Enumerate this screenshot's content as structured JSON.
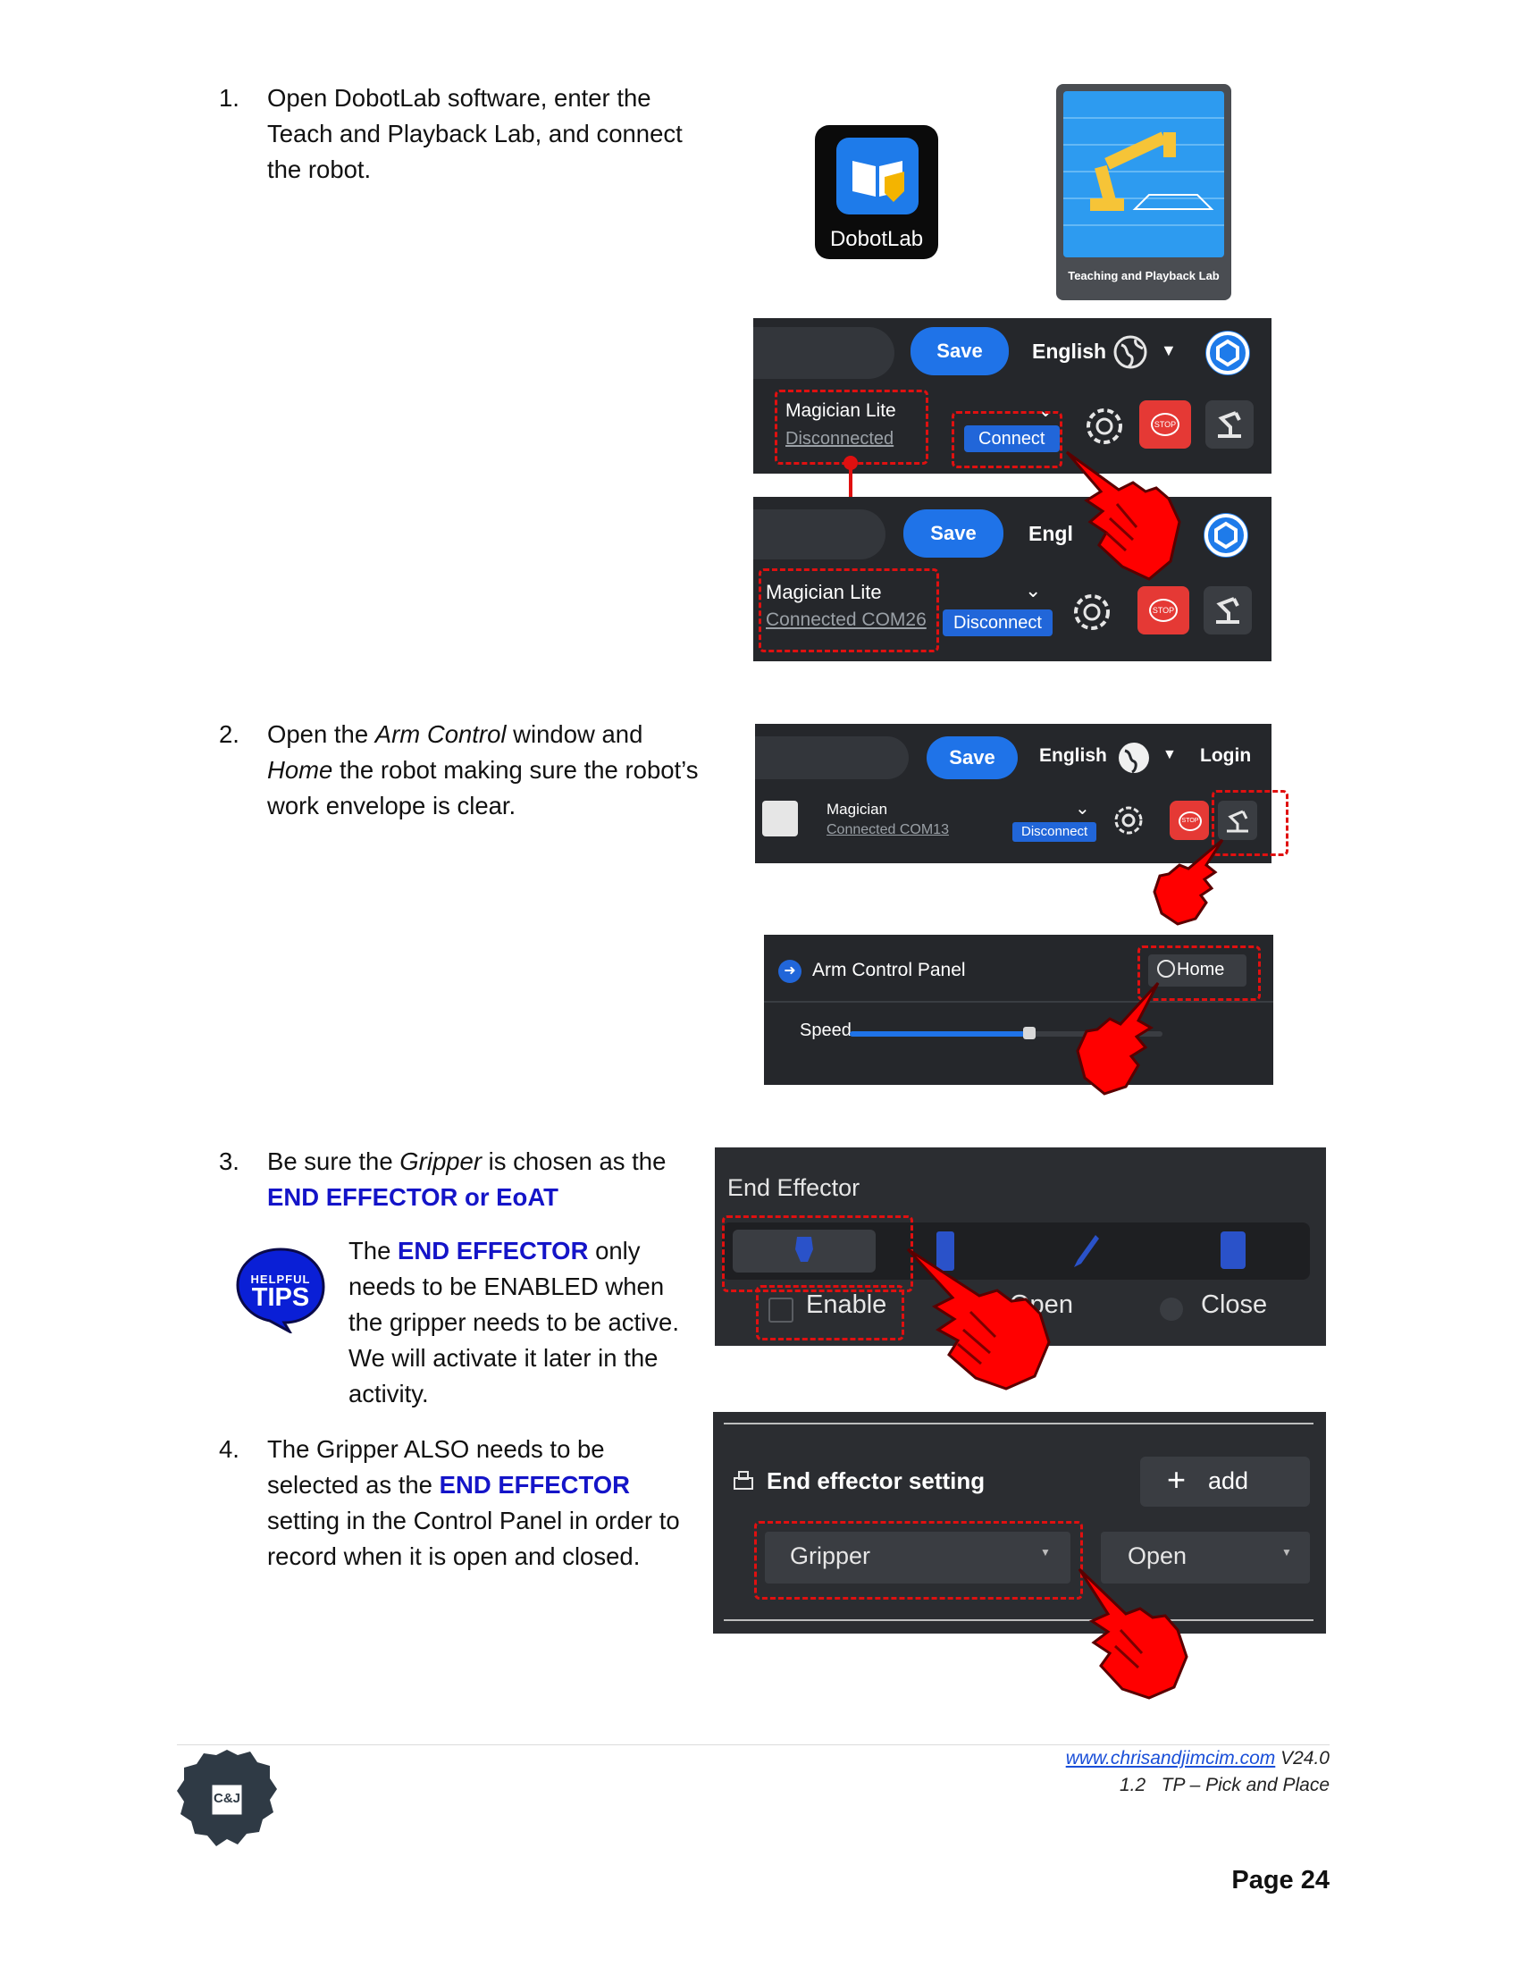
{
  "steps": [
    {
      "num": "1.",
      "text": "Open DobotLab software, enter the Teach and Playback Lab, and connect the robot."
    },
    {
      "num": "2.",
      "pre": "Open the ",
      "em1": "Arm Control",
      "mid": " window and ",
      "em2": "Home",
      "post": " the robot making sure the robot’s work envelope is clear."
    },
    {
      "num": "3.",
      "pre": "Be sure the ",
      "em1": "Gripper",
      "mid": " is chosen as the ",
      "highlight": "END EFFECTOR or EoAT"
    },
    {
      "num": "4.",
      "pre": "The Gripper ALSO needs to be selected as the ",
      "highlight": "END EFFECTOR",
      "post": " setting in the Control Panel in order to record when it is open and closed."
    }
  ],
  "tip": {
    "badge_top": "HELPFUL",
    "badge_main": "TIPS",
    "pre": "The ",
    "highlight": "END EFFECTOR",
    "post": " only needs to be ENABLED when the gripper needs to be active.  We will activate it later in the activity."
  },
  "dobotlab_icon": {
    "label": "DobotLab"
  },
  "teach_lab_tile": {
    "label": "Teaching and Playback Lab"
  },
  "shot1_top": {
    "save": "Save",
    "language": "English",
    "device": "Magician Lite",
    "status": "Disconnected",
    "action": "Connect"
  },
  "shot1_bottom": {
    "save": "Save",
    "language": "Engl",
    "device": "Magician Lite",
    "status": "Connected COM26",
    "action": "Disconnect"
  },
  "stop_label": "STOP",
  "shot2": {
    "save": "Save",
    "language": "English",
    "login": "Login",
    "device": "Magician",
    "status": "Connected COM13",
    "action": "Disconnect"
  },
  "arm_panel": {
    "title": "Arm Control Panel",
    "home": "Home",
    "speed": "Speed"
  },
  "end_effector": {
    "title": "End Effector",
    "enable": "Enable",
    "open": "Open",
    "close": "Close"
  },
  "ee_setting": {
    "title": "End effector setting",
    "add": "add",
    "tool": "Gripper",
    "state": "Open"
  },
  "footer": {
    "url": "www.chrisandjimcim.com",
    "version": "V24.0",
    "section": "1.2   TP – Pick and Place",
    "page": "Page 24",
    "logo_text": "C&J"
  },
  "colors": {
    "accent_blue": "#1414c8",
    "save_blue": "#1f73e8",
    "stop_red": "#e53935",
    "dash_red": "#e01010",
    "panel_dark": "#25272b"
  }
}
